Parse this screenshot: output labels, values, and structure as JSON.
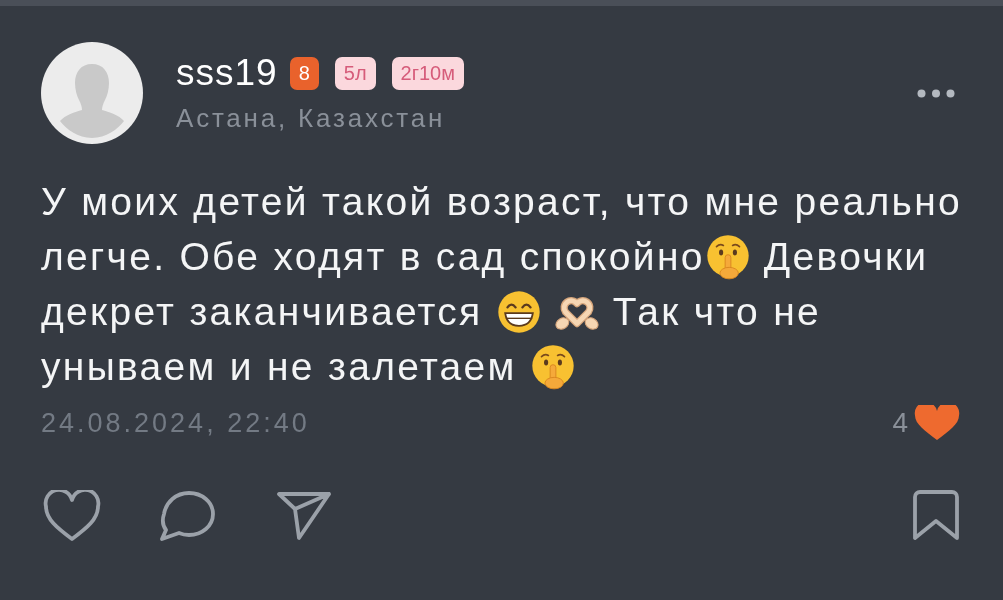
{
  "post": {
    "author": {
      "name": "sss19",
      "badges": [
        {
          "kind": "accent",
          "text": "8"
        },
        {
          "kind": "soft",
          "text": "5л"
        },
        {
          "kind": "soft",
          "text": "2г10м"
        }
      ],
      "location": "Астана, Казахстан"
    },
    "text_lines": [
      [
        {
          "kind": "text",
          "text": "У моих детей такой возраст, что мне реально"
        }
      ],
      [
        {
          "kind": "text",
          "text": "легче. Обе ходят в сад спокойно"
        },
        {
          "kind": "shush"
        },
        {
          "kind": "text",
          "text": " Девочки"
        }
      ],
      [
        {
          "kind": "text",
          "text": "декрет заканчивается "
        },
        {
          "kind": "grin"
        },
        {
          "kind": "hearthands"
        },
        {
          "kind": "text",
          "text": " Так что не"
        }
      ],
      [
        {
          "kind": "text",
          "text": "унываем и не залетаем "
        },
        {
          "kind": "shush"
        }
      ]
    ],
    "date": "24.08.2024, 22:40",
    "likes": "4"
  }
}
